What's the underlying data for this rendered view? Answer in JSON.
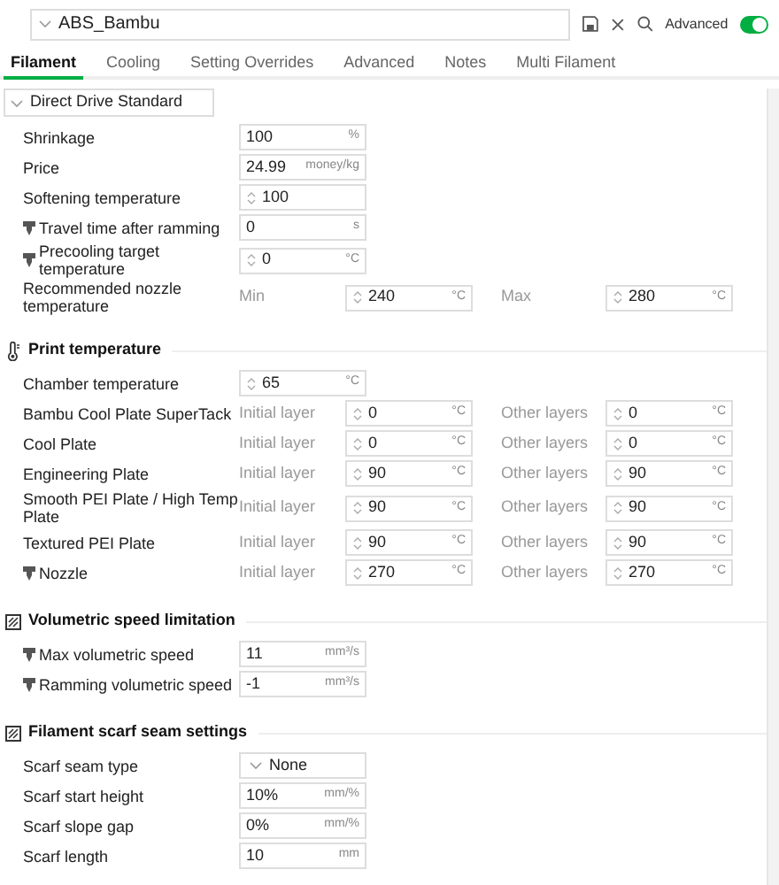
{
  "toolbar": {
    "preset": "ABS_Bambu",
    "advanced_label": "Advanced",
    "advanced_on": true
  },
  "tabs": [
    {
      "label": "Filament",
      "selected": true
    },
    {
      "label": "Cooling",
      "selected": false
    },
    {
      "label": "Setting Overrides",
      "selected": false
    },
    {
      "label": "Advanced",
      "selected": false
    },
    {
      "label": "Notes",
      "selected": false
    },
    {
      "label": "Multi Filament",
      "selected": false
    }
  ],
  "group": "Direct Drive Standard",
  "sections": [
    {
      "rows": [
        {
          "kind": "single",
          "label": "Shrinkage",
          "nozzle": false,
          "field": {
            "value": "100",
            "unit": "%",
            "spinner": false
          }
        },
        {
          "kind": "single",
          "label": "Price",
          "nozzle": false,
          "field": {
            "value": "24.99",
            "unit": "money/kg",
            "spinner": false
          }
        },
        {
          "kind": "single",
          "label": "Softening temperature",
          "nozzle": false,
          "field": {
            "value": "100",
            "spinner": true
          }
        },
        {
          "kind": "single",
          "label": "Travel time after ramming",
          "nozzle": true,
          "field": {
            "value": "0",
            "unit": "s",
            "spinner": false
          }
        },
        {
          "kind": "single",
          "label": "Precooling target temperature",
          "nozzle": true,
          "field": {
            "value": "0",
            "unit": "°C",
            "spinner": true
          }
        },
        {
          "kind": "pair",
          "label": "Recommended nozzle temperature",
          "nozzle": false,
          "left_label": "Min",
          "left": {
            "value": "240",
            "unit": "°C",
            "spinner": true
          },
          "right_label": "Max",
          "right": {
            "value": "280",
            "unit": "°C",
            "spinner": true
          }
        }
      ]
    },
    {
      "title": "Print temperature",
      "kind": "temperature",
      "rows": [
        {
          "kind": "single",
          "label": "Chamber temperature",
          "nozzle": false,
          "field": {
            "value": "65",
            "unit": "°C",
            "spinner": true
          }
        },
        {
          "kind": "pair",
          "label": "Bambu Cool Plate SuperTack",
          "nozzle": false,
          "left_label": "Initial layer",
          "left": {
            "value": "0",
            "unit": "°C",
            "spinner": true
          },
          "right_label": "Other layers",
          "right": {
            "value": "0",
            "unit": "°C",
            "spinner": true
          }
        },
        {
          "kind": "pair",
          "label": "Cool Plate",
          "nozzle": false,
          "left_label": "Initial layer",
          "left": {
            "value": "0",
            "unit": "°C",
            "spinner": true
          },
          "right_label": "Other layers",
          "right": {
            "value": "0",
            "unit": "°C",
            "spinner": true
          }
        },
        {
          "kind": "pair",
          "label": "Engineering Plate",
          "nozzle": false,
          "left_label": "Initial layer",
          "left": {
            "value": "90",
            "unit": "°C",
            "spinner": true
          },
          "right_label": "Other layers",
          "right": {
            "value": "90",
            "unit": "°C",
            "spinner": true
          }
        },
        {
          "kind": "pair",
          "label": "Smooth PEI Plate / High Temp Plate",
          "nozzle": false,
          "left_label": "Initial layer",
          "left": {
            "value": "90",
            "unit": "°C",
            "spinner": true
          },
          "right_label": "Other layers",
          "right": {
            "value": "90",
            "unit": "°C",
            "spinner": true
          }
        },
        {
          "kind": "pair",
          "label": "Textured PEI Plate",
          "nozzle": false,
          "left_label": "Initial layer",
          "left": {
            "value": "90",
            "unit": "°C",
            "spinner": true
          },
          "right_label": "Other layers",
          "right": {
            "value": "90",
            "unit": "°C",
            "spinner": true
          }
        },
        {
          "kind": "pair",
          "label": "Nozzle",
          "nozzle": true,
          "left_label": "Initial layer",
          "left": {
            "value": "270",
            "unit": "°C",
            "spinner": true
          },
          "right_label": "Other layers",
          "right": {
            "value": "270",
            "unit": "°C",
            "spinner": true
          }
        }
      ]
    },
    {
      "title": "Volumetric speed limitation",
      "kind": "limit",
      "rows": [
        {
          "kind": "single",
          "label": "Max volumetric speed",
          "nozzle": true,
          "field": {
            "value": "11",
            "unit": "mm³/s",
            "spinner": false
          }
        },
        {
          "kind": "single",
          "label": "Ramming volumetric speed",
          "nozzle": true,
          "field": {
            "value": "-1",
            "unit": "mm³/s",
            "spinner": false
          }
        }
      ]
    },
    {
      "title": "Filament scarf seam settings",
      "kind": "limit",
      "rows": [
        {
          "kind": "dropdown",
          "label": "Scarf seam type",
          "nozzle": false,
          "value": "None"
        },
        {
          "kind": "single",
          "label": "Scarf start height",
          "nozzle": false,
          "field": {
            "value": "10%",
            "unit": "mm/%",
            "spinner": false
          }
        },
        {
          "kind": "single",
          "label": "Scarf slope gap",
          "nozzle": false,
          "field": {
            "value": "0%",
            "unit": "mm/%",
            "spinner": false
          }
        },
        {
          "kind": "single",
          "label": "Scarf length",
          "nozzle": false,
          "field": {
            "value": "10",
            "unit": "mm",
            "spinner": false
          }
        }
      ]
    }
  ]
}
